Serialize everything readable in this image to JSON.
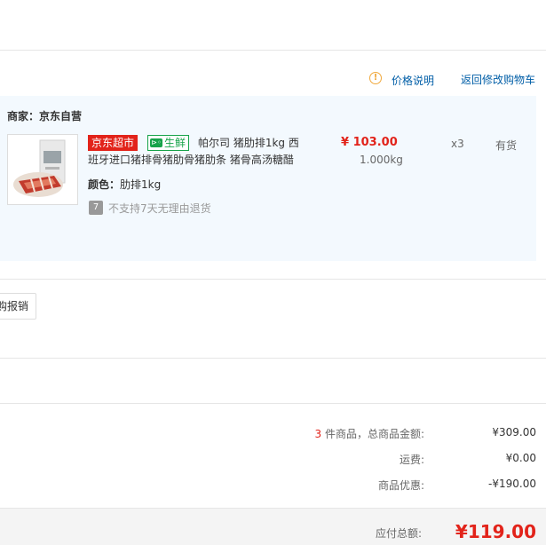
{
  "header": {
    "price_info_label": "价格说明",
    "return_to_cart_label": "返回修改购物车"
  },
  "shop": {
    "merchant_label": "商家：京东自营"
  },
  "product": {
    "tag_supermarket": "京东超市",
    "tag_fresh": "生鲜",
    "name_line1": "帕尔司 猪肋排1kg 西",
    "name_line2": "班牙进口猪排骨猪肋骨猪肋条 猪骨高汤糖醋",
    "attr_label": "颜色：",
    "attr_value": "肋排1kg",
    "return_policy": "不支持7天无理由退货",
    "return_icon_glyph": "7",
    "price": "¥ 103.00",
    "weight": "1.000kg",
    "quantity": "x3",
    "stock": "有货"
  },
  "actions": {
    "reimburse_label": "购报销"
  },
  "summary": {
    "item_count": "3",
    "item_count_suffix": " 件商品，总商品金额:",
    "goods_total": "¥309.00",
    "shipping_label": "运费:",
    "shipping_value": "¥0.00",
    "discount_label": "商品优惠:",
    "discount_value": "-¥190.00",
    "payable_label": "应付总额:",
    "payable_value": "¥119.00"
  },
  "colors": {
    "accent_red": "#e2231a",
    "link_blue": "#005ea7",
    "fresh_green": "#17a34a",
    "product_bg": "#f3f9fe"
  },
  "icons": {
    "info": "info-circle-icon",
    "return": "no-return-7day-icon",
    "fresh": "fish-icon"
  }
}
